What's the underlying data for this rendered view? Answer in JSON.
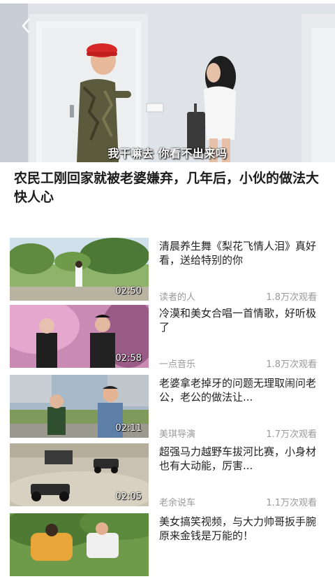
{
  "player": {
    "subtitle": "我干嘛去 你看不出来吗"
  },
  "video": {
    "title": "农民工刚回家就被老婆嫌弃，几年后，小伙的做法大快人心"
  },
  "related": [
    {
      "title": "清晨养生舞《梨花飞情人泪》真好看，送给特别的你",
      "duration": "02:50",
      "author": "读者的人",
      "views": "1.8万次观看"
    },
    {
      "title": "冷漠和美女合唱一首情歌，好听极了",
      "duration": "02:58",
      "author": "一点音乐",
      "views": "1.8万次观看"
    },
    {
      "title": "老婆拿老掉牙的问题无理取闹问老公，老公的做法让...",
      "duration": "02:11",
      "author": "美琪导演",
      "views": "1.7万次观看"
    },
    {
      "title": "超强马力越野车拔河比赛，小身材也有大动能，厉害...",
      "duration": "02:05",
      "author": "老余说车",
      "views": "1.1万次观看"
    },
    {
      "title": "美女搞笑视频，与大力帅哥扳手腕原来金钱是万能的！",
      "duration": "",
      "author": "",
      "views": ""
    }
  ],
  "colors": {
    "title_text": "#1c1c1c",
    "meta_text": "#999999",
    "subtitle_text": "#ffffff"
  },
  "icons": {
    "back": "chevron-left-icon"
  }
}
